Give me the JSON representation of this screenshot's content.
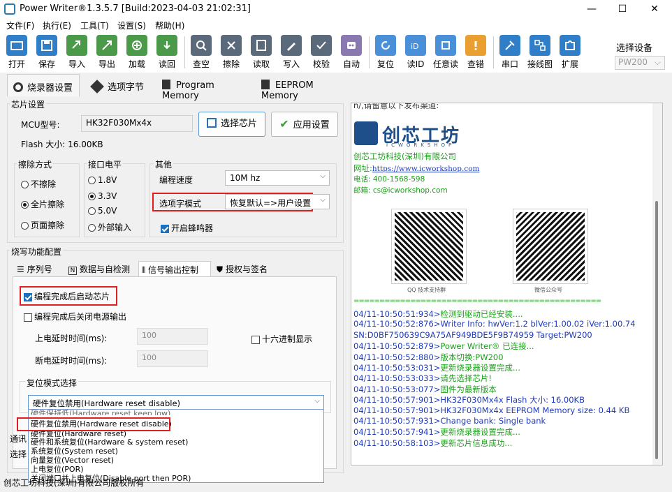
{
  "window": {
    "title": "Power Writer®1.3.5.7 [Build:2023-04-03 21:02:31]",
    "min": "—",
    "max": "☐",
    "close": "✕"
  },
  "menu": [
    "文件(F)",
    "执行(E)",
    "工具(T)",
    "设置(S)",
    "帮助(H)"
  ],
  "toolbar": [
    "打开",
    "保存",
    "导入",
    "导出",
    "加载",
    "读回",
    "查空",
    "擦除",
    "读取",
    "写入",
    "校验",
    "自动",
    "复位",
    "读ID",
    "任意读",
    "查错",
    "串口",
    "接线图",
    "扩展"
  ],
  "device": {
    "label": "选择设备",
    "value": "PW200",
    "chev": "⌵"
  },
  "tabs": [
    "烧录器设置",
    "选项字节",
    "Program Memory",
    "EEPROM Memory"
  ],
  "chip": {
    "group": "芯片设置",
    "mcu_label": "MCU型号:",
    "mcu_value": "HK32F030Mx4x",
    "select_btn": "选择芯片",
    "apply_btn": "应用设置",
    "flash": "Flash 大小: 16.00KB"
  },
  "erase": {
    "title": "擦除方式",
    "options": [
      "不擦除",
      "全片擦除",
      "页面擦除"
    ]
  },
  "level": {
    "title": "接口电平",
    "options": [
      "1.8V",
      "3.3V",
      "5.0V",
      "外部输入"
    ]
  },
  "other": {
    "title": "其他",
    "speed_label": "编程速度",
    "speed_value": "10M hz",
    "mode_label": "选项字模式",
    "mode_value": "恢复默认=>用户设置",
    "buzzer": "开启蜂鸣器"
  },
  "func": {
    "group": "烧写功能配置",
    "subtabs": [
      "序列号",
      "数据与自检测",
      "信号输出控制",
      "授权与签名"
    ],
    "start_chip": "编程完成后启动芯片",
    "power_off": "编程完成后关闭电源输出",
    "power_on_delay": "上电延时时间(ms):",
    "power_off_delay": "断电延时时间(ms):",
    "delay_on_value": "100",
    "delay_off_value": "100",
    "hex": "十六进制显示",
    "reset_group": "复位模式选择",
    "reset_selected": "硬件复位禁用(Hardware reset disable)",
    "reset_options": [
      "硬件保持低(Hardware reset keep low)",
      "硬件复位禁用(Hardware reset disable)",
      "硬件复位(Hardware reset)",
      "硬件和系统复位(Hardware & system reset)",
      "系统复位(System reset)",
      "向量复位(Vector reset)",
      "上电复位(POR)",
      "关闭端口并上电复位(Disable port then POR)"
    ],
    "comm_label": "通讯",
    "select_label": "选择"
  },
  "log": {
    "top_text": "n/,请留意以下发布渠道:",
    "company_name": "创芯工坊",
    "company_sub": "ICWORKSHOP",
    "company": "创芯工坊科技(深圳)有限公司",
    "site_label": "网址:",
    "site": "https://www.icworkshop.com",
    "phone": "电话: 400-1568-598",
    "email": "邮箱: cs@icworkshop.com",
    "qr1": "QQ 技术支持群",
    "qr2": "微信公众号",
    "divider": "================================================",
    "lines": [
      {
        "t": "04/11-10:50:51:934>",
        "m": "检测到驱动已经安装....",
        "c": "grn"
      },
      {
        "t": "04/11-10:50:52:876>",
        "m": "Writer Info:  hwVer:1.2   blVer:1.00.02   iVer:1.00.74",
        "c": "blu"
      },
      {
        "t": "",
        "m": "SN:D0BF750639C9A75AF949BDE5F9B74959 Target:PW200",
        "c": "blu"
      },
      {
        "t": "04/11-10:50:52:879>",
        "m": "Power Writer® 已连接...",
        "c": "grn"
      },
      {
        "t": "04/11-10:50:52:880>",
        "m": "版本切换:PW200",
        "c": "grn"
      },
      {
        "t": "04/11-10:50:53:031>",
        "m": "更新烧录器设置完成...",
        "c": "grn"
      },
      {
        "t": "04/11-10:50:53:033>",
        "m": "请先选择芯片!",
        "c": "grn"
      },
      {
        "t": "04/11-10:50:53:077>",
        "m": "固件为最新版本",
        "c": "grn"
      },
      {
        "t": "04/11-10:50:57:901>",
        "m": "HK32F030Mx4x Flash 大小: 16.00KB",
        "c": "blu"
      },
      {
        "t": "04/11-10:50:57:901>",
        "m": "HK32F030Mx4x EEPROM Memory size: 0.44 KB",
        "c": "blu"
      },
      {
        "t": "04/11-10:50:57:931>",
        "m": "Change bank: Single bank",
        "c": "blu"
      },
      {
        "t": "04/11-10:50:57:941>",
        "m": "更新烧录器设置完成...",
        "c": "grn"
      },
      {
        "t": "04/11-10:50:58:103>",
        "m": "更新芯片信息成功...",
        "c": "grn"
      }
    ]
  },
  "status": "创芯工坊科技(深圳)有限公司版权所有"
}
